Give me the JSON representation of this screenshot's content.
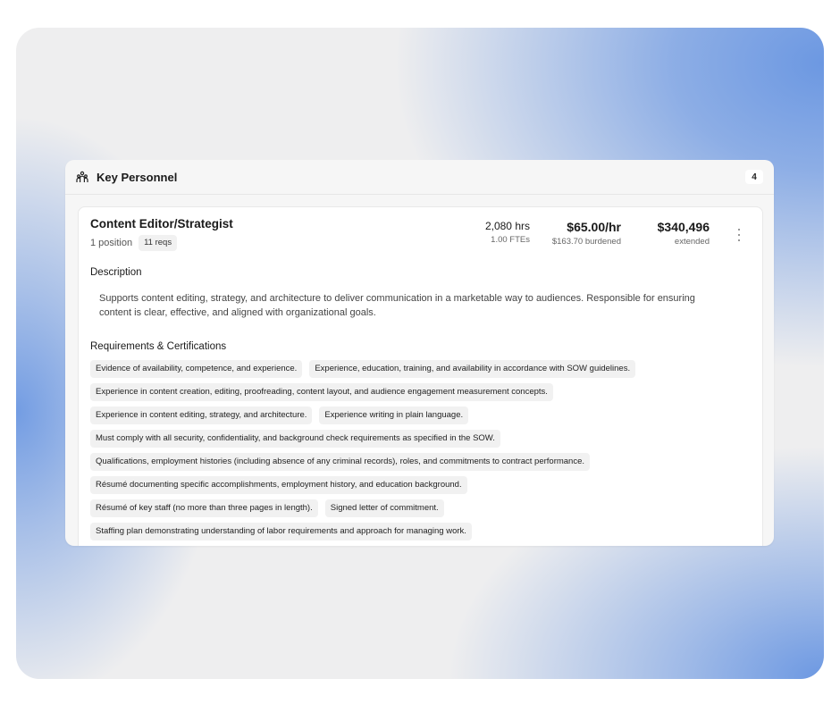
{
  "panel": {
    "title": "Key Personnel",
    "count": "4",
    "icon": "people-group-icon"
  },
  "role": {
    "title": "Content Editor/Strategist",
    "positions": "1 position",
    "reqs_badge": "11 reqs",
    "hours": "2,080 hrs",
    "ftes": "1.00 FTEs",
    "rate": "$65.00/hr",
    "burdened": "$163.70 burdened",
    "extended_value": "$340,496",
    "extended_label": "extended",
    "menu_icon": "more-vertical-icon"
  },
  "description": {
    "label": "Description",
    "text": "Supports content editing, strategy, and architecture to deliver communication in a marketable way to audiences. Responsible for ensuring content is clear, effective, and aligned with organizational goals."
  },
  "requirements": {
    "label": "Requirements & Certifications",
    "rows": [
      [
        "Evidence of availability, competence, and experience.",
        "Experience, education, training, and availability in accordance with SOW guidelines."
      ],
      [
        "Experience in content creation, editing, proofreading, content layout, and audience engagement measurement concepts."
      ],
      [
        "Experience in content editing, strategy, and architecture.",
        "Experience writing in plain language."
      ],
      [
        "Must comply with all security, confidentiality, and background check requirements as specified in the SOW."
      ],
      [
        "Qualifications, employment histories (including absence of any criminal records), roles, and commitments to contract performance."
      ],
      [
        "Résumé documenting specific accomplishments, employment history, and education background."
      ],
      [
        "Résumé of key staff (no more than three pages in length).",
        "Signed letter of commitment."
      ],
      [
        "Staffing plan demonstrating understanding of labor requirements and approach for managing work."
      ]
    ]
  },
  "colors": {
    "accent_blue": "#6c98e2",
    "chip_bg": "#f1f1f1",
    "panel_bg": "#f6f6f6"
  }
}
